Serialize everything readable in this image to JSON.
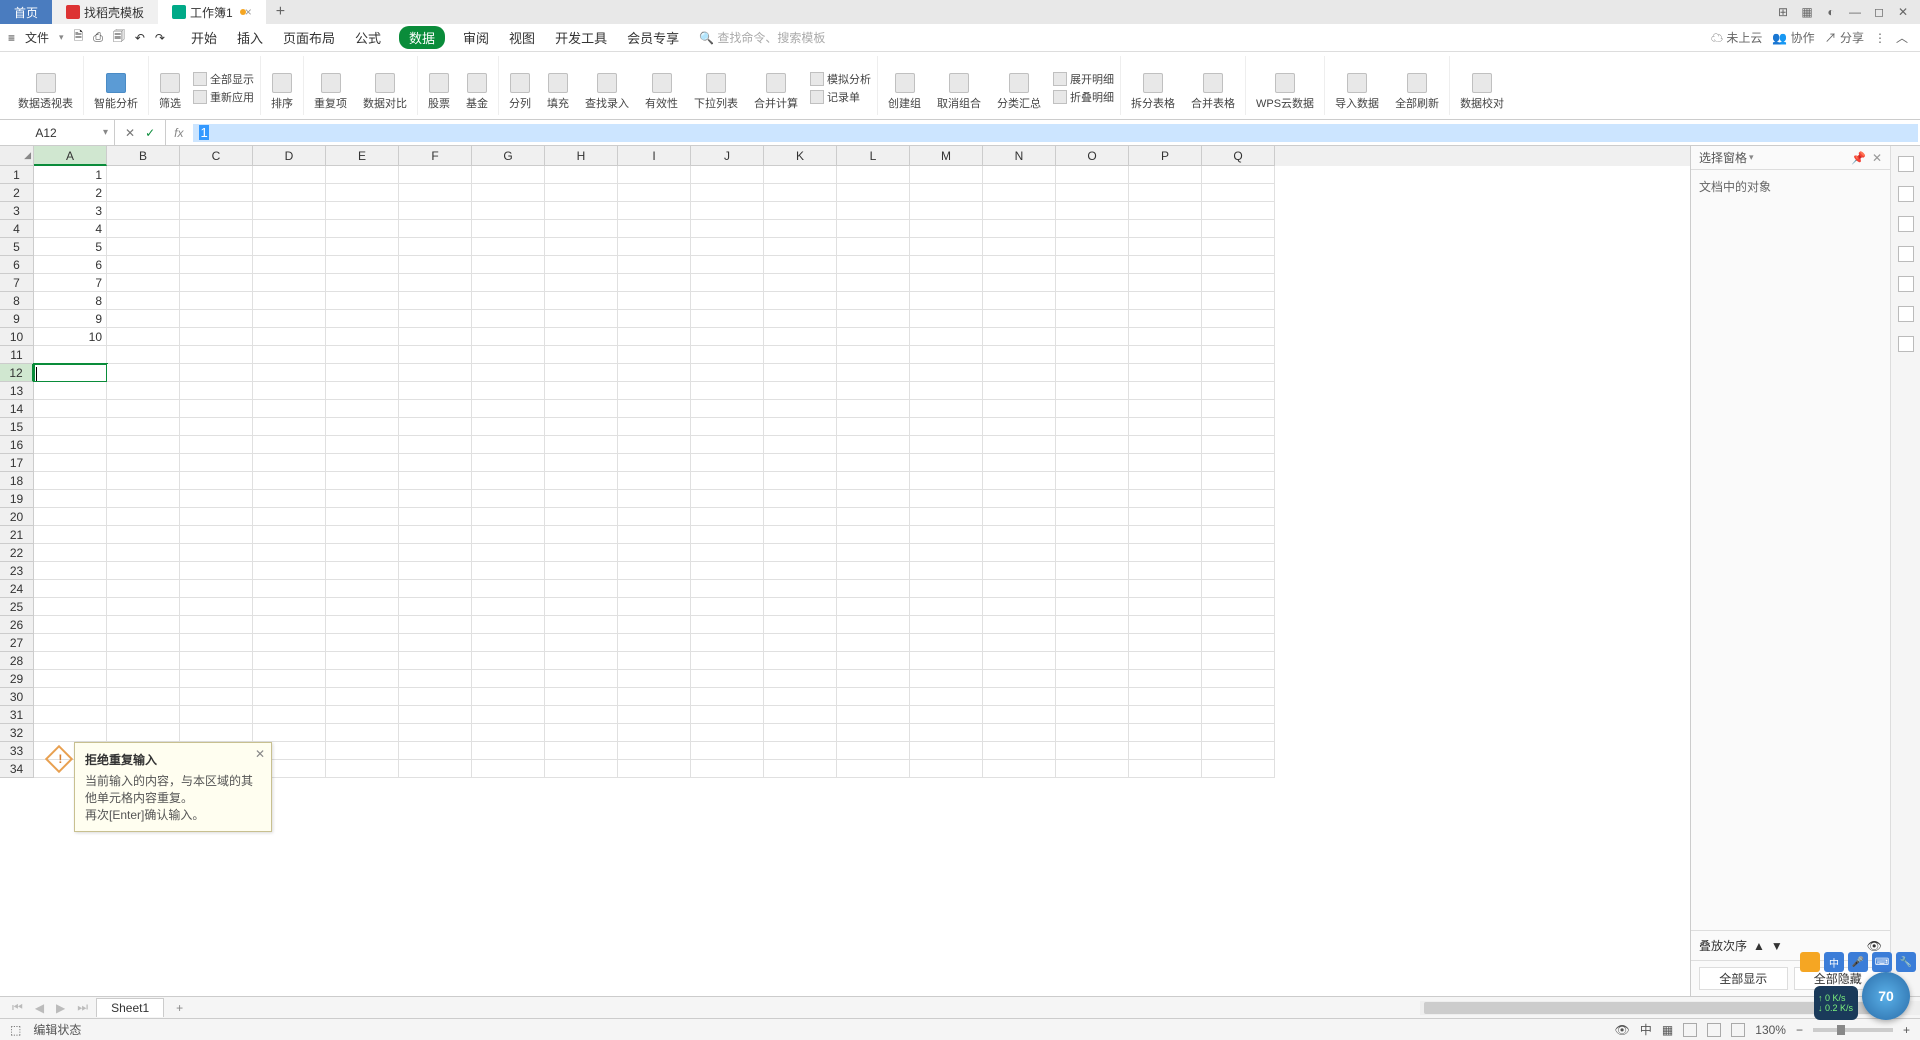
{
  "tabs": {
    "home": "首页",
    "t2": "找稻壳模板",
    "t3": "工作簿1"
  },
  "file_menu": "文件",
  "menus": [
    "开始",
    "插入",
    "页面布局",
    "公式",
    "数据",
    "审阅",
    "视图",
    "开发工具",
    "会员专享"
  ],
  "menu_active_index": 4,
  "search_placeholder": "查找命令、搜索模板",
  "cloud_status": "未上云",
  "collab": "协作",
  "share": "分享",
  "ribbon": {
    "pivot": "数据透视表",
    "ai": "智能分析",
    "filter": "筛选",
    "showall": "全部显示",
    "reapply": "重新应用",
    "sort": "排序",
    "dup": "重复项",
    "compare": "数据对比",
    "stock": "股票",
    "fund": "基金",
    "split": "分列",
    "fill": "填充",
    "findrec": "查找录入",
    "valid": "有效性",
    "dropdown": "下拉列表",
    "consol": "合并计算",
    "record": "记录单",
    "sim": "模拟分析",
    "group": "创建组",
    "ungroup": "取消组合",
    "subtotal": "分类汇总",
    "expand": "展开明细",
    "collapse": "折叠明细",
    "splittbl": "拆分表格",
    "mergetbl": "合并表格",
    "wpscloud": "WPS云数据",
    "import": "导入数据",
    "refresh": "全部刷新",
    "verify": "数据校对"
  },
  "namebox": "A12",
  "formula": "1",
  "columns": [
    "A",
    "B",
    "C",
    "D",
    "E",
    "F",
    "G",
    "H",
    "I",
    "J",
    "K",
    "L",
    "M",
    "N",
    "O",
    "P",
    "Q"
  ],
  "cell_values": [
    "1",
    "2",
    "3",
    "4",
    "5",
    "6",
    "7",
    "8",
    "9",
    "10"
  ],
  "active_row": 12,
  "tooltip": {
    "title": "拒绝重复输入",
    "body1": "当前输入的内容，与本区域的其他单元格内容重复。",
    "body2": "再次[Enter]确认输入。"
  },
  "side": {
    "title": "选择窗格",
    "label": "文档中的对象",
    "order": "叠放次序",
    "showall": "全部显示",
    "hideall": "全部隐藏"
  },
  "sheet": "Sheet1",
  "status": "编辑状态",
  "zoom": "130%",
  "circle": "70",
  "net": {
    "up": "0 K/s",
    "down": "0.2 K/s"
  }
}
